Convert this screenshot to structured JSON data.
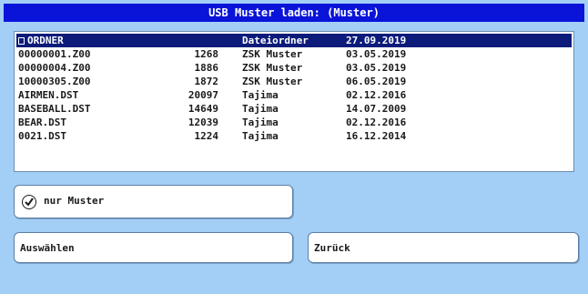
{
  "window": {
    "title": "USB Muster laden: (Muster)"
  },
  "file_list": {
    "rows": [
      {
        "name": "ORDNER",
        "size": "",
        "type": "Dateiordner",
        "date": "27.09.2019",
        "selected": true,
        "is_folder": true
      },
      {
        "name": "00000001.Z00",
        "size": "1268",
        "type": "ZSK Muster",
        "date": "03.05.2019"
      },
      {
        "name": "00000004.Z00",
        "size": "1886",
        "type": "ZSK Muster",
        "date": "03.05.2019"
      },
      {
        "name": "10000305.Z00",
        "size": "1872",
        "type": "ZSK Muster",
        "date": "06.05.2019"
      },
      {
        "name": "AIRMEN.DST",
        "size": "20097",
        "type": "Tajima",
        "date": "02.12.2016"
      },
      {
        "name": "BASEBALL.DST",
        "size": "14649",
        "type": "Tajima",
        "date": "14.07.2009"
      },
      {
        "name": "BEAR.DST",
        "size": "12039",
        "type": "Tajima",
        "date": "02.12.2016"
      },
      {
        "name": "0021.DST",
        "size": "1224",
        "type": "Tajima",
        "date": "16.12.2014"
      }
    ]
  },
  "filter": {
    "label": "nur Muster",
    "checked": true
  },
  "buttons": {
    "select": "Auswählen",
    "back": "Zurück"
  },
  "colors": {
    "background": "#a3cff7",
    "titlebar": "#0a14d8",
    "selection": "#0c1b7a"
  }
}
